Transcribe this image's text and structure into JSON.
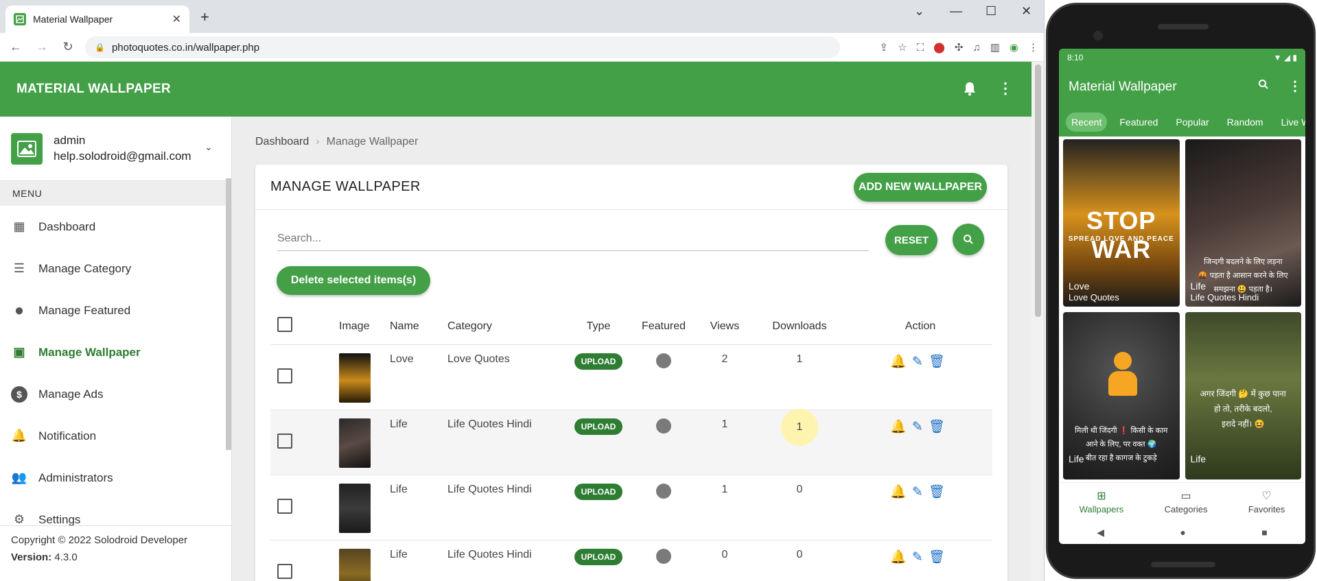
{
  "browser": {
    "tab_title": "Material Wallpaper",
    "url": "photoquotes.co.in/wallpaper.php"
  },
  "app": {
    "brand": "MATERIAL WALLPAPER",
    "user": {
      "name": "admin",
      "email": "help.solodroid@gmail.com"
    },
    "menu_header": "MENU",
    "menu": [
      {
        "label": "Dashboard",
        "icon": "dashboard-icon"
      },
      {
        "label": "Manage Category",
        "icon": "list-icon"
      },
      {
        "label": "Manage Featured",
        "icon": "circle-icon"
      },
      {
        "label": "Manage Wallpaper",
        "icon": "image-icon",
        "active": true
      },
      {
        "label": "Manage Ads",
        "icon": "dollar-icon"
      },
      {
        "label": "Notification",
        "icon": "bell-icon"
      },
      {
        "label": "Administrators",
        "icon": "people-icon"
      },
      {
        "label": "Settings",
        "icon": "gear-icon"
      }
    ],
    "footer": {
      "copyright": "Copyright © 2022 Solodroid Developer",
      "version_label": "Version:",
      "version": "4.3.0"
    },
    "breadcrumb": [
      "Dashboard",
      "Manage Wallpaper"
    ],
    "card_title": "MANAGE WALLPAPER",
    "add_button": "ADD NEW WALLPAPER",
    "search_placeholder": "Search...",
    "reset_button": "RESET",
    "delete_button": "Delete selected items(s)",
    "table": {
      "headers": [
        "Image",
        "Name",
        "Category",
        "Type",
        "Featured",
        "Views",
        "Downloads",
        "Action"
      ],
      "rows": [
        {
          "name": "Love",
          "category": "Love Quotes",
          "type": "UPLOAD",
          "views": "2",
          "downloads": "1"
        },
        {
          "name": "Life",
          "category": "Life Quotes Hindi",
          "type": "UPLOAD",
          "views": "1",
          "downloads": "1"
        },
        {
          "name": "Life",
          "category": "Life Quotes Hindi",
          "type": "UPLOAD",
          "views": "1",
          "downloads": "0"
        },
        {
          "name": "Life",
          "category": "Life Quotes Hindi",
          "type": "UPLOAD",
          "views": "0",
          "downloads": "0"
        }
      ]
    },
    "accent_color": "#43a047"
  },
  "phone": {
    "time": "8:10",
    "title": "Material Wallpaper",
    "tabs": [
      "Recent",
      "Featured",
      "Popular",
      "Random",
      "Live W"
    ],
    "tiles": [
      {
        "category": "Love",
        "subtitle": "Love Quotes",
        "headline": "STOP WAR",
        "tagline": "SPREAD LOVE AND PEACE"
      },
      {
        "category": "Life",
        "subtitle": "Life Quotes Hindi",
        "line1": "जिन्दगी बदलने के लिए लड़ना",
        "line2": "🤬 पड़ता है आसान करने के लिए",
        "line3": "समझना 😃 पड़ता है।"
      },
      {
        "category": "Life",
        "line1": "मिली थी जिंदगी ❗ किसी के काम",
        "line2": "आने के लिए, पर वक्त 🌍",
        "line3": "बीत रहा है कागज के टुकड़े"
      },
      {
        "category": "Life",
        "line1": "अगर जिंदगी 🤔 में कुछ पाना",
        "line2": "हो तो, तरीके बदलो,",
        "line3": "इरादे नहीं। 😆"
      }
    ],
    "bottom_nav": [
      "Wallpapers",
      "Categories",
      "Favorites"
    ]
  }
}
